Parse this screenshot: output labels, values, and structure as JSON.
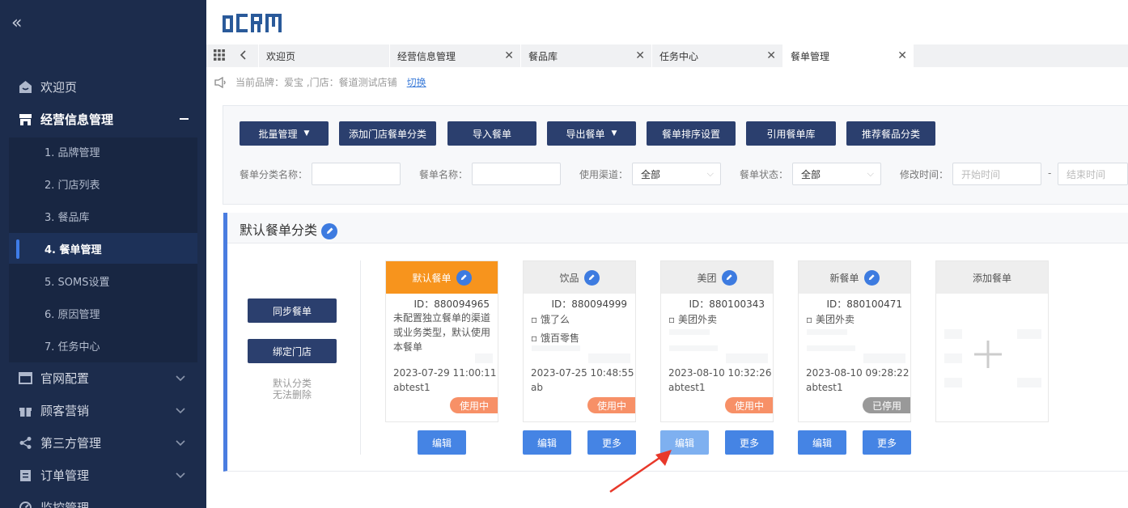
{
  "logo": {
    "text": "oCRM"
  },
  "sidebar": {
    "menu": [
      {
        "label": "欢迎页",
        "icon": "home-icon"
      },
      {
        "label": "经营信息管理",
        "icon": "store-icon"
      },
      {
        "label": "官网配置",
        "icon": "browser-icon"
      },
      {
        "label": "顾客营销",
        "icon": "gift-icon"
      },
      {
        "label": "第三方管理",
        "icon": "share-icon"
      },
      {
        "label": "订单管理",
        "icon": "clipboard-icon"
      },
      {
        "label": "监控管理",
        "icon": "monitor-icon"
      }
    ],
    "submenu": [
      "1. 品牌管理",
      "2. 门店列表",
      "3. 餐品库",
      "4. 餐单管理",
      "5. SOMS设置",
      "6. 原因管理",
      "7. 任务中心"
    ],
    "active_submenu": "4. 餐单管理"
  },
  "tabs": [
    {
      "label": "欢迎页"
    },
    {
      "label": "经营信息管理"
    },
    {
      "label": "餐品库"
    },
    {
      "label": "任务中心"
    },
    {
      "label": "餐单管理",
      "active": true
    }
  ],
  "notice": {
    "text": "当前品牌：爱宝 ,门店：餐道测试店铺",
    "switch_label": "切换"
  },
  "toolbar": {
    "batch": "批量管理",
    "add_category": "添加门店餐单分类",
    "import": "导入餐单",
    "export": "导出餐单",
    "sort": "餐单排序设置",
    "ref_library": "引用餐单库",
    "recommend": "推荐餐品分类"
  },
  "filters": {
    "category_label": "餐单分类名称：",
    "name_label": "餐单名称：",
    "channel_label": "使用渠道：",
    "channel_value": "全部",
    "status_label": "餐单状态：",
    "status_value": "全部",
    "time_label": "修改时间：",
    "start_placeholder": "开始时间",
    "sep": "-",
    "end_placeholder": "结束时间"
  },
  "section": {
    "title": "默认餐单分类",
    "sync_button": "同步餐单",
    "bind_button": "绑定门店",
    "note_line1": "默认分类",
    "note_line2": "无法删除"
  },
  "cards": [
    {
      "title": "默认餐单",
      "id": "ID：880094965",
      "desc": "未配置独立餐单的渠道或业务类型，默认使用本餐单",
      "channels": [],
      "date": "2023-07-29 11:00:11",
      "user": "abtest1",
      "status": "使用中",
      "edit": "编辑"
    },
    {
      "title": "饮品",
      "id": "ID：880094999",
      "desc": "",
      "channels": [
        "▫ 饿了么",
        "▫ 饿百零售"
      ],
      "date": "2023-07-25 10:48:55",
      "user": "ab",
      "status": "使用中",
      "edit": "编辑",
      "more": "更多"
    },
    {
      "title": "美团",
      "id": "ID：880100343",
      "desc": "",
      "channels": [
        "▫ 美团外卖"
      ],
      "date": "2023-08-10 10:32:26",
      "user": "abtest1",
      "status": "使用中",
      "edit": "编辑",
      "more": "更多"
    },
    {
      "title": "新餐单",
      "id": "ID：880100471",
      "desc": "",
      "channels": [
        "▫ 美团外卖"
      ],
      "date": "2023-08-10 09:28:22",
      "user": "abtest1",
      "status": "已停用",
      "edit": "编辑",
      "more": "更多"
    }
  ],
  "add_card": {
    "title": "添加餐单"
  },
  "colors": {
    "sidebar": "#1c2c4c",
    "accent": "#4584e4",
    "navy_button": "#2b3f6e",
    "orange": "#f7941d",
    "badge_active": "#f79067",
    "badge_disabled": "#999999",
    "annotation_arrow": "#e8382a"
  }
}
